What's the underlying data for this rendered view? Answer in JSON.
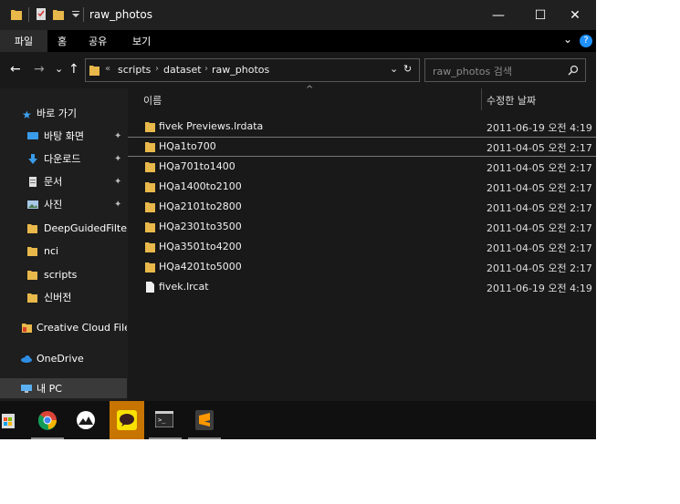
{
  "window": {
    "title": "raw_photos",
    "controls": {
      "minimize": "—",
      "maximize": "☐",
      "close": "✕"
    }
  },
  "ribbon": {
    "tabs": [
      "파일",
      "홈",
      "공유",
      "보기"
    ],
    "help": "?",
    "expand": "⌄"
  },
  "address": {
    "back": "←",
    "forward": "→",
    "recent": "⌄",
    "up": "↑",
    "overflow": "«",
    "crumbs": [
      "scripts",
      "dataset",
      "raw_photos"
    ],
    "dropdown": "⌄",
    "refresh": "↻"
  },
  "search": {
    "placeholder": "raw_photos 검색"
  },
  "sidebar": {
    "items": [
      {
        "label": "바로 가기",
        "icon": "star-icon"
      },
      {
        "label": "바탕 화면",
        "icon": "desktop-icon",
        "pinned": true
      },
      {
        "label": "다운로드",
        "icon": "download-icon",
        "pinned": true
      },
      {
        "label": "문서",
        "icon": "document-icon",
        "pinned": true
      },
      {
        "label": "사진",
        "icon": "picture-icon",
        "pinned": true
      },
      {
        "label": "DeepGuidedFilterin",
        "icon": "folder-icon"
      },
      {
        "label": "nci",
        "icon": "folder-icon"
      },
      {
        "label": "scripts",
        "icon": "folder-icon"
      },
      {
        "label": "신버전",
        "icon": "folder-icon"
      },
      {
        "label": "Creative Cloud Files",
        "icon": "creative-cloud-icon"
      },
      {
        "label": "OneDrive",
        "icon": "cloud-icon"
      },
      {
        "label": "내 PC",
        "icon": "computer-icon"
      }
    ],
    "pin_glyph": "📌"
  },
  "list": {
    "columns": {
      "name": "이름",
      "date": "수정한 날짜"
    },
    "sort_indicator": "^",
    "rows": [
      {
        "name": "fivek Previews.lrdata",
        "date": "2011-06-19 오전 4:19",
        "type": "folder"
      },
      {
        "name": "HQa1to700",
        "date": "2011-04-05 오전 2:17",
        "type": "folder"
      },
      {
        "name": "HQa701to1400",
        "date": "2011-04-05 오전 2:17",
        "type": "folder"
      },
      {
        "name": "HQa1400to2100",
        "date": "2011-04-05 오전 2:17",
        "type": "folder"
      },
      {
        "name": "HQa2101to2800",
        "date": "2011-04-05 오전 2:17",
        "type": "folder"
      },
      {
        "name": "HQa2301to3500",
        "date": "2011-04-05 오전 2:17",
        "type": "folder"
      },
      {
        "name": "HQa3501to4200",
        "date": "2011-04-05 오전 2:17",
        "type": "folder"
      },
      {
        "name": "HQa4201to5000",
        "date": "2011-04-05 오전 2:17",
        "type": "folder"
      },
      {
        "name": "fivek.lrcat",
        "date": "2011-06-19 오전 4:19",
        "type": "file"
      }
    ]
  },
  "taskbar": {
    "apps": [
      "store-icon",
      "chrome-icon",
      "app-mountain-icon",
      "kakaotalk-icon",
      "terminal-icon",
      "sublime-text-icon"
    ],
    "active_app": "kakaotalk-icon"
  },
  "colors": {
    "folder": "#e8b84a",
    "accent_blue": "#1e90ff",
    "active_taskbar": "#c77400"
  }
}
